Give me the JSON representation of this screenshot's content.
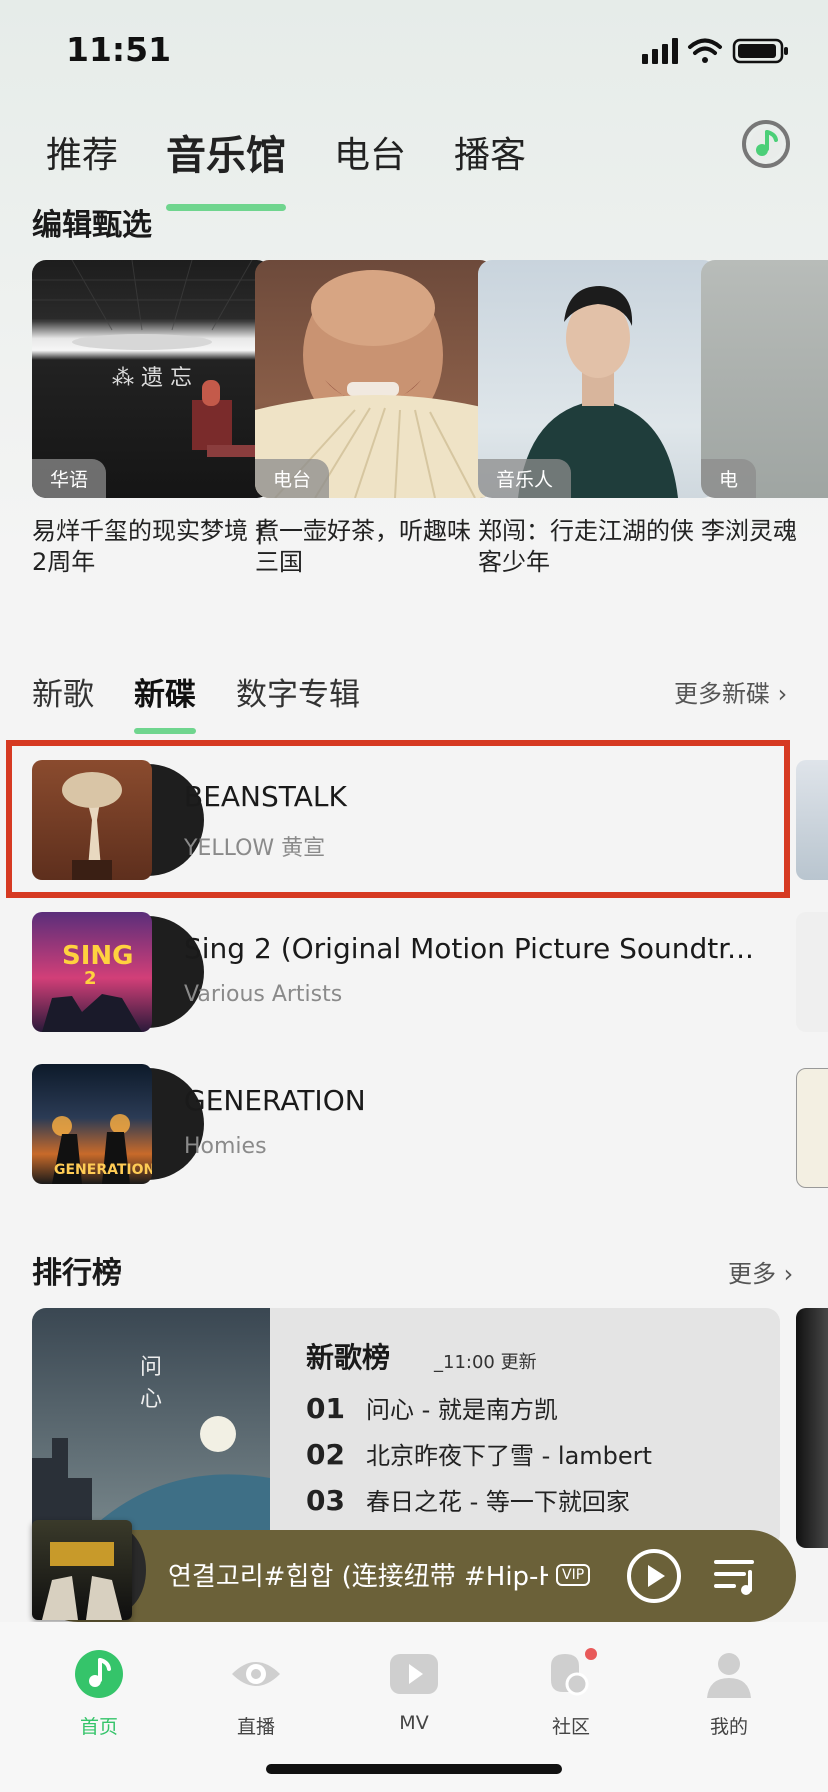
{
  "status": {
    "time": "11:51"
  },
  "top_tabs": [
    {
      "label": "推荐"
    },
    {
      "label": "音乐馆"
    },
    {
      "label": "电台"
    },
    {
      "label": "播客"
    }
  ],
  "editor_picks": {
    "title": "编辑甄选",
    "cards": [
      {
        "badge": "华语",
        "title": "易烊千玺的现实梦境 | 2周年"
      },
      {
        "badge": "电台",
        "title": "煮一壶好茶，听趣味三国"
      },
      {
        "badge": "音乐人",
        "title": "郑闯：行走江湖的侠客少年"
      },
      {
        "badge": "电",
        "title": "李浏灵魂"
      }
    ]
  },
  "new_music": {
    "tabs": [
      {
        "label": "新歌"
      },
      {
        "label": "新碟"
      },
      {
        "label": "数字专辑"
      }
    ],
    "more_label": "更多新碟",
    "albums": [
      {
        "name": "BEANSTALK",
        "artist": "YELLOW 黄宣"
      },
      {
        "name": "Sing 2 (Original Motion Picture Soundtr...",
        "artist": "Various Artists"
      },
      {
        "name": "GENERATION",
        "artist": "Homies"
      }
    ]
  },
  "charts": {
    "title": "排行榜",
    "more_label": "更多",
    "card": {
      "name": "新歌榜",
      "updated": "_11:00 更新",
      "rows": [
        {
          "rank": "01",
          "song": "问心 - 就是南方凯"
        },
        {
          "rank": "02",
          "song": "北京昨夜下了雪 - lambert"
        },
        {
          "rank": "03",
          "song": "春日之花 - 等一下就回家"
        }
      ]
    }
  },
  "player": {
    "title": "연결고리#힙합 (连接纽带 #Hip-Hop)",
    "vip": "VIP"
  },
  "bottom_tabs": [
    {
      "label": "首页"
    },
    {
      "label": "直播"
    },
    {
      "label": "MV"
    },
    {
      "label": "社区"
    },
    {
      "label": "我的"
    }
  ],
  "colors": {
    "accent": "#35c46a",
    "highlight": "#d63a22",
    "player_bg": "#6b6139"
  }
}
